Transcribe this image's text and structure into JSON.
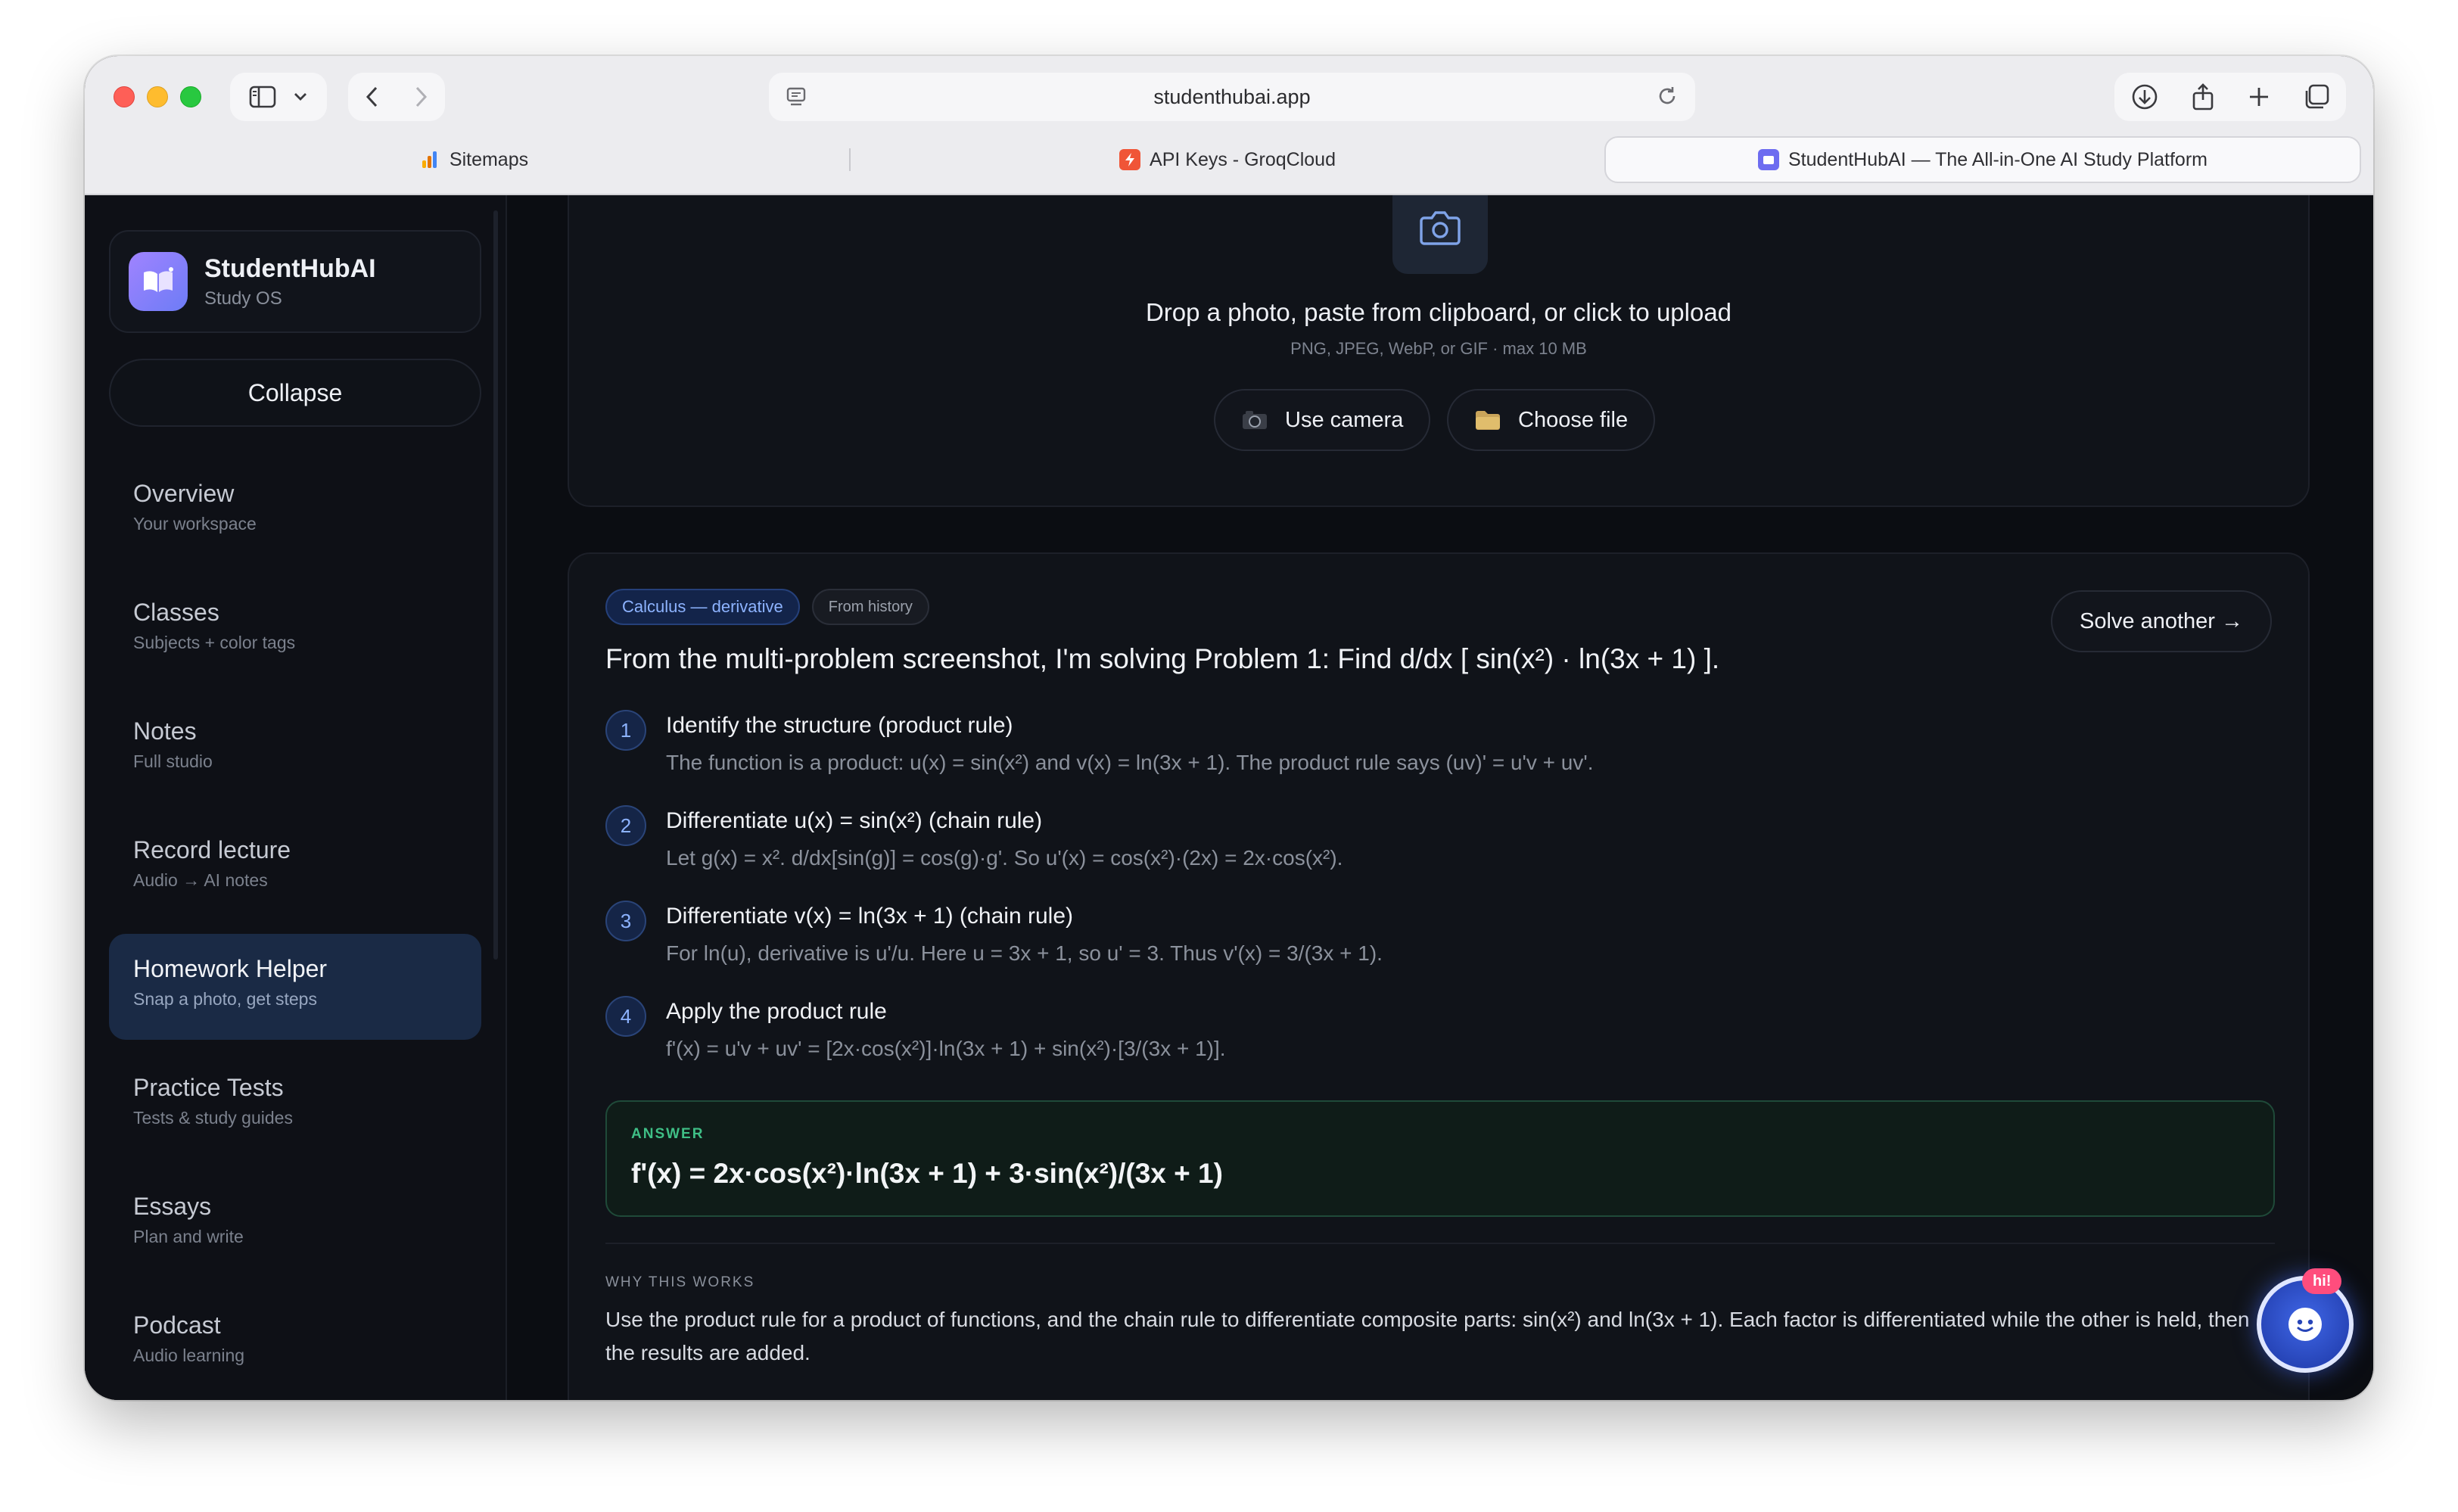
{
  "browser": {
    "url": "studenthubai.app",
    "tabs": [
      {
        "label": "Sitemaps"
      },
      {
        "label": "API Keys - GroqCloud"
      },
      {
        "label": "StudentHubAI — The All-in-One AI Study Platform"
      }
    ]
  },
  "sidebar": {
    "brand_name": "StudentHubAI",
    "brand_sub": "Study OS",
    "collapse_label": "Collapse",
    "items": [
      {
        "label": "Overview",
        "sub": "Your workspace"
      },
      {
        "label": "Classes",
        "sub": "Subjects + color tags"
      },
      {
        "label": "Notes",
        "sub": "Full studio"
      },
      {
        "label": "Record lecture",
        "sub": "Audio → AI notes"
      },
      {
        "label": "Homework Helper",
        "sub": "Snap a photo, get steps"
      },
      {
        "label": "Practice Tests",
        "sub": "Tests & study guides"
      },
      {
        "label": "Essays",
        "sub": "Plan and write"
      },
      {
        "label": "Podcast",
        "sub": "Audio learning"
      }
    ],
    "active_item": "Homework Helper"
  },
  "upload": {
    "title": "Drop a photo, paste from clipboard, or click to upload",
    "subtitle": "PNG, JPEG, WebP, or GIF · max 10 MB",
    "camera_button": "Use camera",
    "file_button": "Choose file"
  },
  "solution": {
    "topic_badge": "Calculus — derivative",
    "source_badge": "From history",
    "solve_another": "Solve another →",
    "problem": "From the multi-problem screenshot, I'm solving Problem 1: Find d/dx [ sin(x²) · ln(3x + 1) ].",
    "steps": [
      {
        "num": "1",
        "title": "Identify the structure (product rule)",
        "desc": "The function is a product: u(x) = sin(x²) and v(x) = ln(3x + 1). The product rule says (uv)' = u'v + uv'."
      },
      {
        "num": "2",
        "title": "Differentiate u(x) = sin(x²) (chain rule)",
        "desc": "Let g(x) = x². d/dx[sin(g)] = cos(g)·g'. So u'(x) = cos(x²)·(2x) = 2x·cos(x²)."
      },
      {
        "num": "3",
        "title": "Differentiate v(x) = ln(3x + 1) (chain rule)",
        "desc": "For ln(u), derivative is u'/u. Here u = 3x + 1, so u' = 3. Thus v'(x) = 3/(3x + 1)."
      },
      {
        "num": "4",
        "title": "Apply the product rule",
        "desc": "f'(x) = u'v + uv' = [2x·cos(x²)]·ln(3x + 1) + sin(x²)·[3/(3x + 1)]."
      }
    ],
    "answer_label": "ANSWER",
    "answer": "f'(x) = 2x·cos(x²)·ln(3x + 1) + 3·sin(x²)/(3x + 1)",
    "why_label": "WHY THIS WORKS",
    "why_text": "Use the product rule for a product of functions, and the chain rule to differentiate composite parts: sin(x²) and ln(3x + 1). Each factor is differentiated while the other is held, then the results are added."
  },
  "chat": {
    "badge": "hi!"
  },
  "colors": {
    "accent": "#8db3ff",
    "active_nav": "#1a2a45",
    "answer_green": "#3fbf86",
    "background": "#0b0d12"
  }
}
